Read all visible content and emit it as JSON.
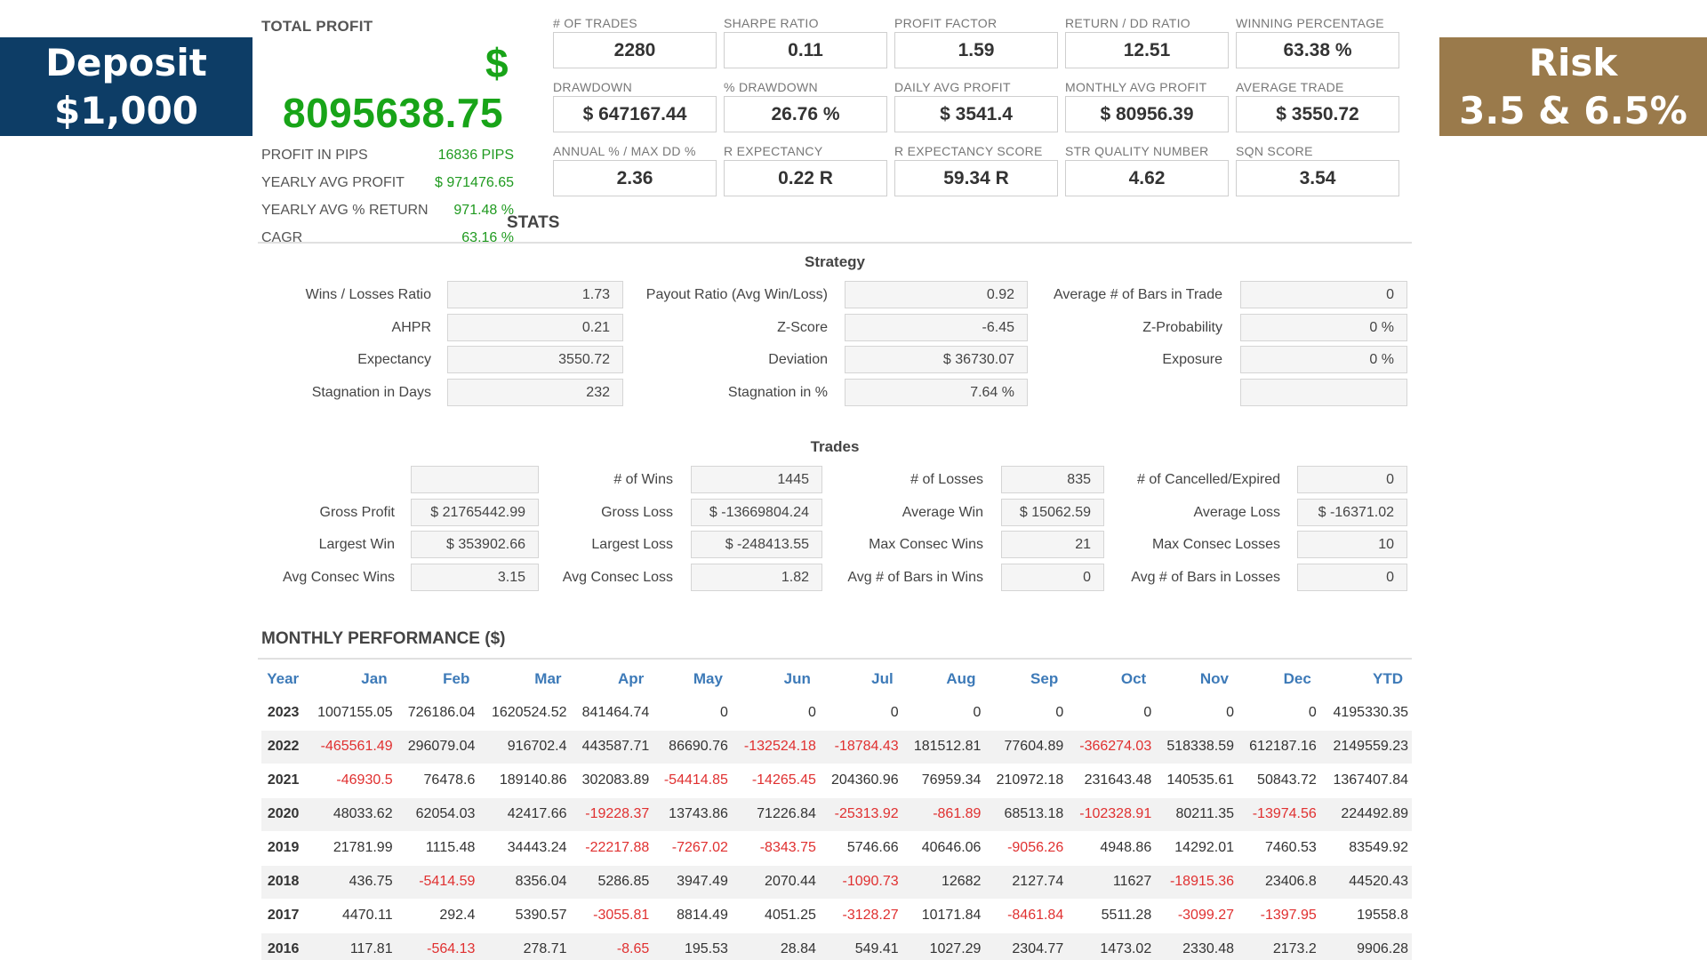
{
  "banners": {
    "left": {
      "line1": "Deposit",
      "line2": "$1,000"
    },
    "right": {
      "line1": "Risk",
      "line2": "3.5 & 6.5%"
    }
  },
  "summary": {
    "total_label": "TOTAL PROFIT",
    "currency": "$",
    "total_value": "8095638.75",
    "rows": [
      {
        "label": "PROFIT IN PIPS",
        "value": "16836 PIPS"
      },
      {
        "label": "YEARLY AVG PROFIT",
        "value": "$ 971476.65"
      },
      {
        "label": "YEARLY AVG % RETURN",
        "value": "971.48 %"
      },
      {
        "label": "CAGR",
        "value": "63.16 %"
      }
    ]
  },
  "metrics": [
    {
      "label": "# OF TRADES",
      "value": "2280"
    },
    {
      "label": "SHARPE RATIO",
      "value": "0.11"
    },
    {
      "label": "PROFIT FACTOR",
      "value": "1.59"
    },
    {
      "label": "RETURN / DD RATIO",
      "value": "12.51"
    },
    {
      "label": "WINNING PERCENTAGE",
      "value": "63.38 %"
    },
    {
      "label": "DRAWDOWN",
      "value": "$ 647167.44"
    },
    {
      "label": "% DRAWDOWN",
      "value": "26.76 %"
    },
    {
      "label": "DAILY AVG PROFIT",
      "value": "$ 3541.4"
    },
    {
      "label": "MONTHLY AVG PROFIT",
      "value": "$ 80956.39"
    },
    {
      "label": "AVERAGE TRADE",
      "value": "$ 3550.72"
    },
    {
      "label": "ANNUAL % / MAX DD %",
      "value": "2.36"
    },
    {
      "label": "R EXPECTANCY",
      "value": "0.22 R"
    },
    {
      "label": "R EXPECTANCY SCORE",
      "value": "59.34 R"
    },
    {
      "label": "STR QUALITY NUMBER",
      "value": "4.62"
    },
    {
      "label": "SQN SCORE",
      "value": "3.54"
    }
  ],
  "stats_title": "STATS",
  "strategy": {
    "title": "Strategy",
    "col1": [
      {
        "label": "Wins / Losses Ratio",
        "value": "1.73"
      },
      {
        "label": "AHPR",
        "value": "0.21"
      },
      {
        "label": "Expectancy",
        "value": "3550.72"
      },
      {
        "label": "Stagnation in Days",
        "value": "232"
      }
    ],
    "col2": [
      {
        "label": "Payout Ratio (Avg Win/Loss)",
        "value": "0.92"
      },
      {
        "label": "Z-Score",
        "value": "-6.45"
      },
      {
        "label": "Deviation",
        "value": "$ 36730.07"
      },
      {
        "label": "Stagnation in %",
        "value": "7.64 %"
      }
    ],
    "col3": [
      {
        "label": "Average # of Bars in Trade",
        "value": "0"
      },
      {
        "label": "Z-Probability",
        "value": "0 %"
      },
      {
        "label": "Exposure",
        "value": "0 %"
      },
      {
        "label": "",
        "value": ""
      }
    ]
  },
  "trades": {
    "title": "Trades",
    "col1": [
      {
        "label": "",
        "value": ""
      },
      {
        "label": "Gross Profit",
        "value": "$ 21765442.99"
      },
      {
        "label": "Largest Win",
        "value": "$ 353902.66"
      },
      {
        "label": "Avg Consec Wins",
        "value": "3.15"
      }
    ],
    "col2": [
      {
        "label": "# of Wins",
        "value": "1445"
      },
      {
        "label": "Gross Loss",
        "value": "$ -13669804.24"
      },
      {
        "label": "Largest Loss",
        "value": "$ -248413.55"
      },
      {
        "label": "Avg Consec Loss",
        "value": "1.82"
      }
    ],
    "col3": [
      {
        "label": "# of Losses",
        "value": "835"
      },
      {
        "label": "Average Win",
        "value": "$ 15062.59"
      },
      {
        "label": "Max Consec Wins",
        "value": "21"
      },
      {
        "label": "Avg # of Bars in Wins",
        "value": "0"
      }
    ],
    "col4": [
      {
        "label": "# of Cancelled/Expired",
        "value": "0"
      },
      {
        "label": "Average Loss",
        "value": "$ -16371.02"
      },
      {
        "label": "Max Consec Losses",
        "value": "10"
      },
      {
        "label": "Avg # of Bars in Losses",
        "value": "0"
      }
    ]
  },
  "monthly": {
    "title": "MONTHLY PERFORMANCE ($)",
    "headers": [
      "Year",
      "Jan",
      "Feb",
      "Mar",
      "Apr",
      "May",
      "Jun",
      "Jul",
      "Aug",
      "Sep",
      "Oct",
      "Nov",
      "Dec",
      "YTD"
    ],
    "rows": [
      [
        "2023",
        "1007155.05",
        "726186.04",
        "1620524.52",
        "841464.74",
        "0",
        "0",
        "0",
        "0",
        "0",
        "0",
        "0",
        "0",
        "4195330.35"
      ],
      [
        "2022",
        "-465561.49",
        "296079.04",
        "916702.4",
        "443587.71",
        "86690.76",
        "-132524.18",
        "-18784.43",
        "181512.81",
        "77604.89",
        "-366274.03",
        "518338.59",
        "612187.16",
        "2149559.23"
      ],
      [
        "2021",
        "-46930.5",
        "76478.6",
        "189140.86",
        "302083.89",
        "-54414.85",
        "-14265.45",
        "204360.96",
        "76959.34",
        "210972.18",
        "231643.48",
        "140535.61",
        "50843.72",
        "1367407.84"
      ],
      [
        "2020",
        "48033.62",
        "62054.03",
        "42417.66",
        "-19228.37",
        "13743.86",
        "71226.84",
        "-25313.92",
        "-861.89",
        "68513.18",
        "-102328.91",
        "80211.35",
        "-13974.56",
        "224492.89"
      ],
      [
        "2019",
        "21781.99",
        "1115.48",
        "34443.24",
        "-22217.88",
        "-7267.02",
        "-8343.75",
        "5746.66",
        "40646.06",
        "-9056.26",
        "4948.86",
        "14292.01",
        "7460.53",
        "83549.92"
      ],
      [
        "2018",
        "436.75",
        "-5414.59",
        "8356.04",
        "5286.85",
        "3947.49",
        "2070.44",
        "-1090.73",
        "12682",
        "2127.74",
        "11627",
        "-18915.36",
        "23406.8",
        "44520.43"
      ],
      [
        "2017",
        "4470.11",
        "292.4",
        "5390.57",
        "-3055.81",
        "8814.49",
        "4051.25",
        "-3128.27",
        "10171.84",
        "-8461.84",
        "5511.28",
        "-3099.27",
        "-1397.95",
        "19558.8"
      ],
      [
        "2016",
        "117.81",
        "-564.13",
        "278.71",
        "-8.65",
        "195.53",
        "28.84",
        "549.41",
        "1027.29",
        "2304.77",
        "1473.02",
        "2330.48",
        "2173.2",
        "9906.28"
      ]
    ]
  },
  "colors": {
    "positive": "#18a418",
    "negative": "#e03030",
    "header_blue": "#3d7ab8",
    "banner_left": "#0d3d66",
    "banner_right": "#9a7a4b"
  }
}
